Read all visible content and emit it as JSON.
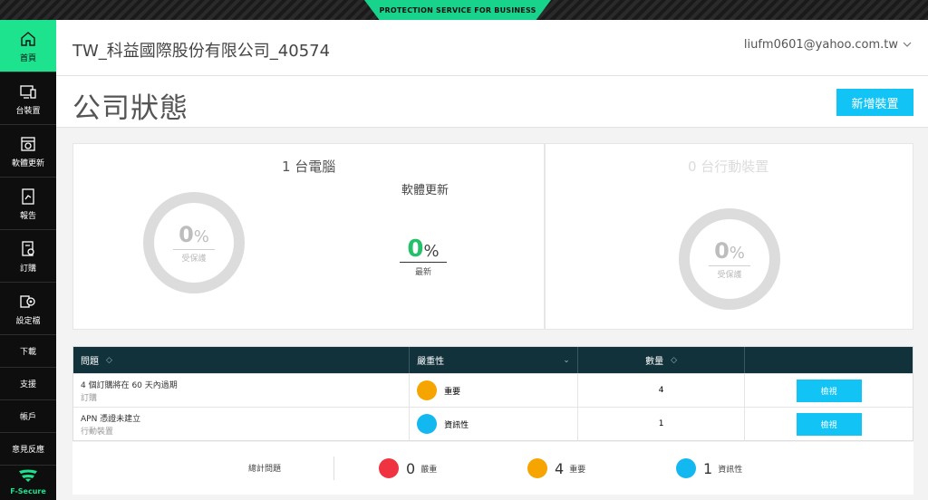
{
  "banner": {
    "text": "PROTECTION SERVICE FOR BUSINESS"
  },
  "sidebar": {
    "items": [
      {
        "label": "首頁",
        "icon": "home-icon"
      },
      {
        "label": "台裝置",
        "icon": "devices-icon"
      },
      {
        "label": "軟體更新",
        "icon": "software-update-icon"
      },
      {
        "label": "報告",
        "icon": "report-icon"
      },
      {
        "label": "訂購",
        "icon": "subscription-icon"
      },
      {
        "label": "設定檔",
        "icon": "settings-profile-icon"
      },
      {
        "label": "下載"
      },
      {
        "label": "支援"
      },
      {
        "label": "帳戶"
      },
      {
        "label": "意見反應"
      }
    ],
    "brand": "F-Secure"
  },
  "header": {
    "company": "TW_科益國際股份有限公司_40574",
    "user": "liufm0601@yahoo.com.tw"
  },
  "page": {
    "title": "公司狀態",
    "add_device": "新增裝置"
  },
  "computers": {
    "title": "1 台電腦",
    "protected_pct": "0",
    "pct_sign": "%",
    "protected_label": "受保護",
    "update_title": "軟體更新",
    "update_pct": "0",
    "update_label": "最新"
  },
  "mobile": {
    "title": "0 台行動裝置",
    "protected_pct": "0",
    "pct_sign": "%",
    "protected_label": "受保護"
  },
  "issues": {
    "headers": [
      "問題",
      "嚴重性",
      "數量",
      ""
    ],
    "rows": [
      {
        "name": "4 個訂購將在 60 天內過期",
        "category": "訂購",
        "severity": "重要",
        "severity_color": "#f5a400",
        "count": "4",
        "action": "檢視"
      },
      {
        "name": "APN 憑證未建立",
        "category": "行動裝置",
        "severity": "資訊性",
        "severity_color": "#14b8f0",
        "count": "1",
        "action": "檢視"
      }
    ]
  },
  "summary": {
    "label": "總計問題",
    "items": [
      {
        "count": "0",
        "label": "嚴重",
        "color": "#ef3340"
      },
      {
        "count": "4",
        "label": "重要",
        "color": "#f5a400"
      },
      {
        "count": "1",
        "label": "資訊性",
        "color": "#14b8f0"
      }
    ]
  }
}
